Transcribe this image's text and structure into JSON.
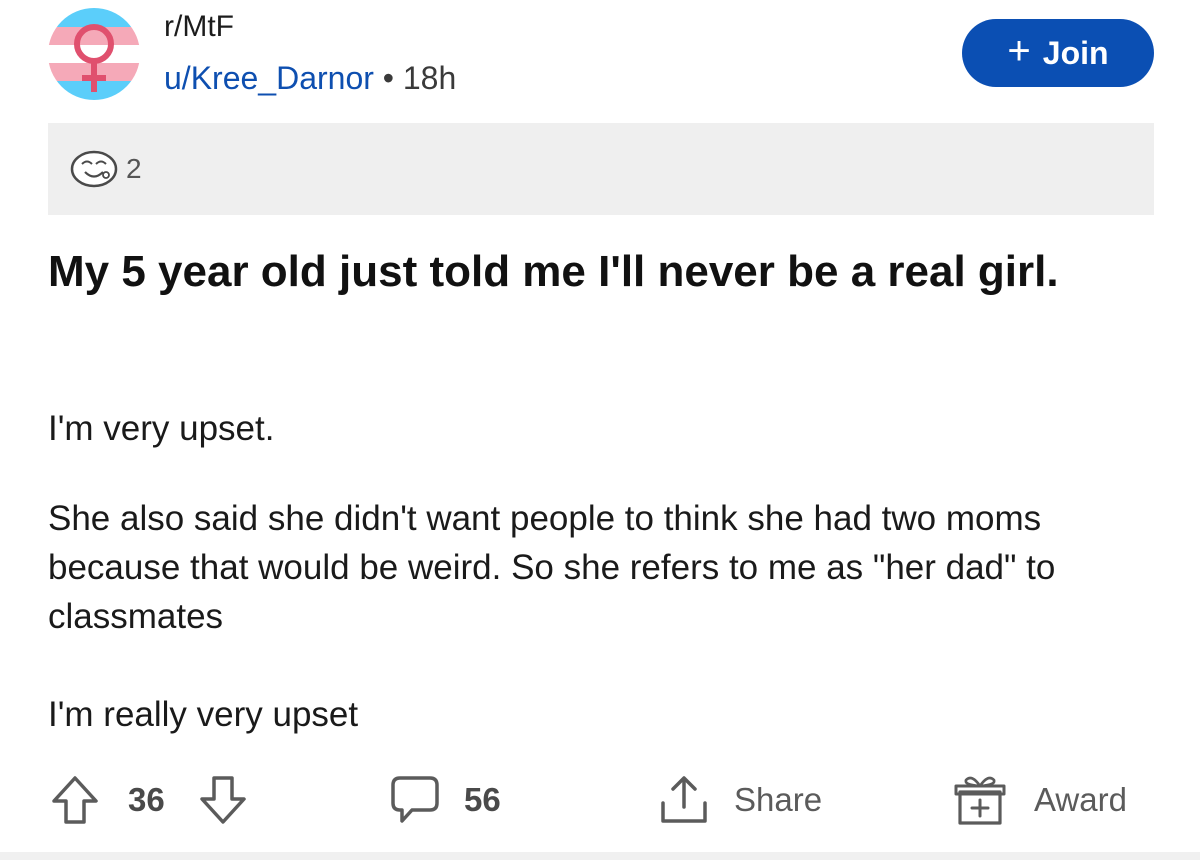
{
  "header": {
    "subreddit": "r/MtF",
    "username": "u/Kree_Darnor",
    "separator": "•",
    "age": "18h",
    "join_plus": "+",
    "join_label": "Join"
  },
  "awards": {
    "count": "2"
  },
  "post": {
    "title": "My 5 year old just told me I'll never be a real girl.",
    "paragraphs": [
      "I'm very upset.",
      "She also said she didn't want people to think she had two moms because that would be weird. So she refers to me as \"her dad\" to classmates",
      "I'm really very upset"
    ]
  },
  "actions": {
    "vote_count": "36",
    "comment_count": "56",
    "share_label": "Share",
    "award_label": "Award"
  },
  "colors": {
    "trans_blue": "#5BCEFA",
    "trans_pink": "#F5A9B8",
    "symbol": "#e0506e",
    "accent": "#0b4fb3"
  },
  "icons": {
    "avatar": "trans-flag-venus-icon",
    "award_strip": "awesome-answer-face-icon",
    "upvote": "arrow-up-icon",
    "downvote": "arrow-down-icon",
    "comment": "comment-bubble-icon",
    "share": "share-upload-icon",
    "award": "gift-box-icon"
  }
}
